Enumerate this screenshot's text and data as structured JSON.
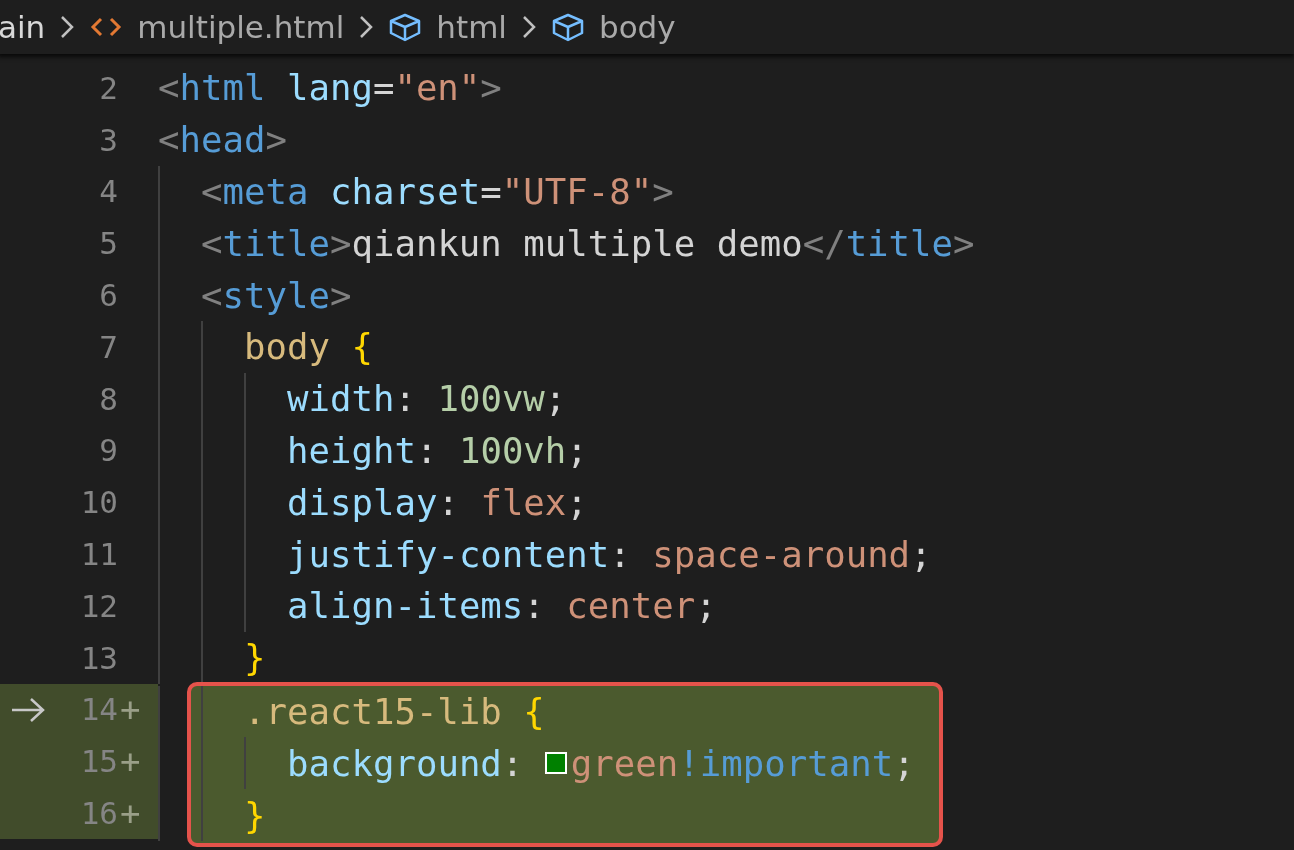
{
  "breadcrumbs": [
    {
      "label": "ain",
      "kind": "folder"
    },
    {
      "label": "multiple.html",
      "kind": "file"
    },
    {
      "label": "html",
      "kind": "element"
    },
    {
      "label": "body",
      "kind": "element"
    }
  ],
  "lines": [
    {
      "number": "2",
      "added": false,
      "current": false,
      "highlighted": false,
      "tokens": [
        {
          "kind": "punct",
          "text": "<"
        },
        {
          "kind": "tag",
          "text": "html"
        },
        {
          "kind": "attr",
          "text": " lang"
        },
        {
          "kind": "text",
          "text": "="
        },
        {
          "kind": "string",
          "text": "\"en\""
        },
        {
          "kind": "punct",
          "text": ">"
        }
      ]
    },
    {
      "number": "3",
      "added": false,
      "current": false,
      "highlighted": false,
      "tokens": [
        {
          "kind": "punct",
          "text": "<"
        },
        {
          "kind": "tag",
          "text": "head"
        },
        {
          "kind": "punct",
          "text": ">"
        }
      ],
      "children": [
        {
          "number": "4",
          "added": false,
          "current": false,
          "highlighted": false,
          "tokens": [
            {
              "kind": "punct",
              "text": "<"
            },
            {
              "kind": "tag",
              "text": "meta"
            },
            {
              "kind": "attr",
              "text": " charset"
            },
            {
              "kind": "text",
              "text": "="
            },
            {
              "kind": "string",
              "text": "\"UTF-8\""
            },
            {
              "kind": "punct",
              "text": ">"
            }
          ]
        },
        {
          "number": "5",
          "added": false,
          "current": false,
          "highlighted": false,
          "tokens": [
            {
              "kind": "punct",
              "text": "<"
            },
            {
              "kind": "tag",
              "text": "title"
            },
            {
              "kind": "punct",
              "text": ">"
            },
            {
              "kind": "text",
              "text": "qiankun multiple demo"
            },
            {
              "kind": "punct",
              "text": "</"
            },
            {
              "kind": "tag",
              "text": "title"
            },
            {
              "kind": "punct",
              "text": ">"
            }
          ]
        },
        {
          "number": "6",
          "added": false,
          "current": false,
          "highlighted": false,
          "tokens": [
            {
              "kind": "punct",
              "text": "<"
            },
            {
              "kind": "tag",
              "text": "style"
            },
            {
              "kind": "punct",
              "text": ">"
            }
          ],
          "children": [
            {
              "number": "7",
              "added": false,
              "current": false,
              "highlighted": false,
              "tokens": [
                {
                  "kind": "selector",
                  "text": "body"
                },
                {
                  "kind": "brace",
                  "text": " {"
                }
              ],
              "children": [
                {
                  "number": "8",
                  "added": false,
                  "current": false,
                  "highlighted": false,
                  "tokens": [
                    {
                      "kind": "property",
                      "text": "width"
                    },
                    {
                      "kind": "text",
                      "text": ": "
                    },
                    {
                      "kind": "number",
                      "text": "100vw"
                    },
                    {
                      "kind": "text",
                      "text": ";"
                    }
                  ]
                },
                {
                  "number": "9",
                  "added": false,
                  "current": false,
                  "highlighted": false,
                  "tokens": [
                    {
                      "kind": "property",
                      "text": "height"
                    },
                    {
                      "kind": "text",
                      "text": ": "
                    },
                    {
                      "kind": "number",
                      "text": "100vh"
                    },
                    {
                      "kind": "text",
                      "text": ";"
                    }
                  ]
                },
                {
                  "number": "10",
                  "added": false,
                  "current": false,
                  "highlighted": false,
                  "tokens": [
                    {
                      "kind": "property",
                      "text": "display"
                    },
                    {
                      "kind": "text",
                      "text": ": "
                    },
                    {
                      "kind": "value",
                      "text": "flex"
                    },
                    {
                      "kind": "text",
                      "text": ";"
                    }
                  ]
                },
                {
                  "number": "11",
                  "added": false,
                  "current": false,
                  "highlighted": false,
                  "tokens": [
                    {
                      "kind": "property",
                      "text": "justify-content"
                    },
                    {
                      "kind": "text",
                      "text": ": "
                    },
                    {
                      "kind": "value",
                      "text": "space-around"
                    },
                    {
                      "kind": "text",
                      "text": ";"
                    }
                  ]
                },
                {
                  "number": "12",
                  "added": false,
                  "current": false,
                  "highlighted": false,
                  "tokens": [
                    {
                      "kind": "property",
                      "text": "align-items"
                    },
                    {
                      "kind": "text",
                      "text": ": "
                    },
                    {
                      "kind": "value",
                      "text": "center"
                    },
                    {
                      "kind": "text",
                      "text": ";"
                    }
                  ]
                }
              ]
            },
            {
              "number": "13",
              "added": false,
              "current": false,
              "highlighted": false,
              "tokens": [
                {
                  "kind": "brace",
                  "text": "}"
                }
              ]
            },
            {
              "number": "14",
              "added": true,
              "gutter_mark": "+",
              "current": true,
              "highlighted": true,
              "tokens": [
                {
                  "kind": "selector",
                  "text": ".react15-lib"
                },
                {
                  "kind": "brace",
                  "text": " {"
                }
              ],
              "children": [
                {
                  "number": "15",
                  "added": true,
                  "gutter_mark": "+",
                  "current": false,
                  "highlighted": true,
                  "tokens": [
                    {
                      "kind": "property",
                      "text": "background"
                    },
                    {
                      "kind": "text",
                      "text": ": "
                    },
                    {
                      "kind": "swatch",
                      "color": "#008000"
                    },
                    {
                      "kind": "value",
                      "text": "green"
                    },
                    {
                      "kind": "keyword",
                      "text": "!important"
                    },
                    {
                      "kind": "text",
                      "text": ";"
                    }
                  ]
                }
              ]
            },
            {
              "number": "16",
              "added": true,
              "gutter_mark": "+",
              "current": false,
              "highlighted": true,
              "tokens": [
                {
                  "kind": "brace",
                  "text": "}"
                }
              ]
            }
          ]
        }
      ]
    }
  ]
}
